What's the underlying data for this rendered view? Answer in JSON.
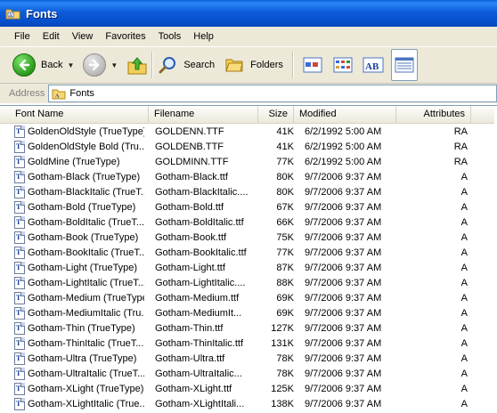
{
  "window": {
    "title": "Fonts",
    "title_icon": "folder-icon"
  },
  "menu": [
    "File",
    "Edit",
    "View",
    "Favorites",
    "Tools",
    "Help"
  ],
  "toolbar": {
    "back_label": "Back",
    "search_label": "Search",
    "folders_label": "Folders"
  },
  "address": {
    "label": "Address",
    "value": "Fonts"
  },
  "columns": {
    "name": "Font Name",
    "filename": "Filename",
    "size": "Size",
    "modified": "Modified",
    "attributes": "Attributes"
  },
  "rows": [
    {
      "name": "GoldenOldStyle (TrueType)",
      "file": "GOLDENN.TTF",
      "size": "41K",
      "mod": "6/2/1992 5:00 AM",
      "attr": "RA"
    },
    {
      "name": "GoldenOldStyle Bold (Tru...",
      "file": "GOLDENB.TTF",
      "size": "41K",
      "mod": "6/2/1992 5:00 AM",
      "attr": "RA"
    },
    {
      "name": "GoldMine (TrueType)",
      "file": "GOLDMINN.TTF",
      "size": "77K",
      "mod": "6/2/1992 5:00 AM",
      "attr": "RA"
    },
    {
      "name": "Gotham-Black (TrueType)",
      "file": "Gotham-Black.ttf",
      "size": "80K",
      "mod": "9/7/2006 9:37 AM",
      "attr": "A"
    },
    {
      "name": "Gotham-BlackItalic (TrueT...",
      "file": "Gotham-BlackItalic....",
      "size": "80K",
      "mod": "9/7/2006 9:37 AM",
      "attr": "A"
    },
    {
      "name": "Gotham-Bold (TrueType)",
      "file": "Gotham-Bold.ttf",
      "size": "67K",
      "mod": "9/7/2006 9:37 AM",
      "attr": "A"
    },
    {
      "name": "Gotham-BoldItalic (TrueT...",
      "file": "Gotham-BoldItalic.ttf",
      "size": "66K",
      "mod": "9/7/2006 9:37 AM",
      "attr": "A"
    },
    {
      "name": "Gotham-Book (TrueType)",
      "file": "Gotham-Book.ttf",
      "size": "75K",
      "mod": "9/7/2006 9:37 AM",
      "attr": "A"
    },
    {
      "name": "Gotham-BookItalic (TrueT...",
      "file": "Gotham-BookItalic.ttf",
      "size": "77K",
      "mod": "9/7/2006 9:37 AM",
      "attr": "A"
    },
    {
      "name": "Gotham-Light (TrueType)",
      "file": "Gotham-Light.ttf",
      "size": "87K",
      "mod": "9/7/2006 9:37 AM",
      "attr": "A"
    },
    {
      "name": "Gotham-LightItalic (TrueT...",
      "file": "Gotham-LightItalic....",
      "size": "88K",
      "mod": "9/7/2006 9:37 AM",
      "attr": "A"
    },
    {
      "name": "Gotham-Medium (TrueType)",
      "file": "Gotham-Medium.ttf",
      "size": "69K",
      "mod": "9/7/2006 9:37 AM",
      "attr": "A"
    },
    {
      "name": "Gotham-MediumItalic (Tru...",
      "file": "Gotham-MediumIt...",
      "size": "69K",
      "mod": "9/7/2006 9:37 AM",
      "attr": "A"
    },
    {
      "name": "Gotham-Thin (TrueType)",
      "file": "Gotham-Thin.ttf",
      "size": "127K",
      "mod": "9/7/2006 9:37 AM",
      "attr": "A"
    },
    {
      "name": "Gotham-ThinItalic (TrueT...",
      "file": "Gotham-ThinItalic.ttf",
      "size": "131K",
      "mod": "9/7/2006 9:37 AM",
      "attr": "A"
    },
    {
      "name": "Gotham-Ultra (TrueType)",
      "file": "Gotham-Ultra.ttf",
      "size": "78K",
      "mod": "9/7/2006 9:37 AM",
      "attr": "A"
    },
    {
      "name": "Gotham-UltraItalic (TrueT...",
      "file": "Gotham-UltraItalic...",
      "size": "78K",
      "mod": "9/7/2006 9:37 AM",
      "attr": "A"
    },
    {
      "name": "Gotham-XLight (TrueType)",
      "file": "Gotham-XLight.ttf",
      "size": "125K",
      "mod": "9/7/2006 9:37 AM",
      "attr": "A"
    },
    {
      "name": "Gotham-XLightItalic (True...",
      "file": "Gotham-XLightItali...",
      "size": "138K",
      "mod": "9/7/2006 9:37 AM",
      "attr": "A"
    }
  ],
  "colors": {
    "titlebar": "#0c5bd9",
    "chrome": "#ece9d8",
    "border": "#7f9db9"
  }
}
